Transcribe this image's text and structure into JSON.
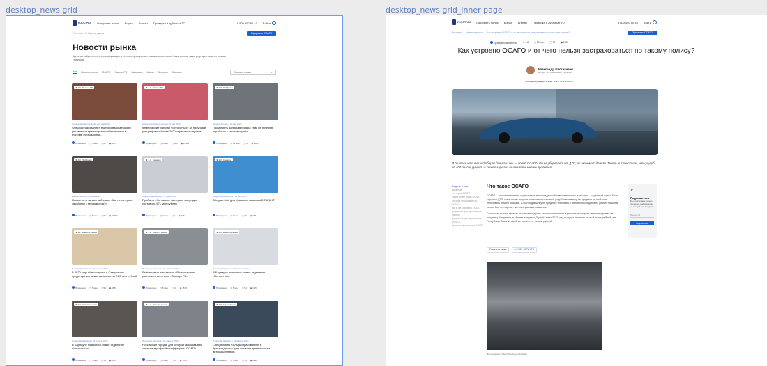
{
  "frames": {
    "grid_label": "desktop_news grid",
    "inner_label": "desktop_news grid_inner page"
  },
  "header": {
    "logo_top": "РОССТРАХ",
    "logo_sub": "Онлайн Страхование",
    "nav": [
      "Оформить полис",
      "Биржа",
      "Агенты",
      "Проверка и дубликат ТО"
    ],
    "phone": "8 800 550 50 43",
    "login": "Войти"
  },
  "grid_page": {
    "breadcrumb": "Росстрах → Новости рынка",
    "cta": "Оформить ОСАГО",
    "title": "Новости рынка",
    "intro": "Здесь вы найдете полезную информацию в статьях, проверенных нашими экспертами. Наши авторы также регулярно пишут о разных тематиках.",
    "tabs": [
      "Все",
      "Новости рынка",
      "ОСАГО",
      "Законы РФ",
      "Лайфхаки",
      "Акции",
      "Вопросы",
      "Санкции"
    ],
    "sort": "Сначала новые",
    "cards": [
      {
        "rating": "4.3",
        "label": "Законы РФ",
        "meta": "Александра Евстигнеева • 19 мая 2023",
        "title": "«Альфастрахование» застраховало автопарк управления транспортного обеспечения в Ростове учитывая нов...",
        "v": "Проверено",
        "time": "7 мин",
        "c": "22",
        "views": "1579",
        "color": "#7a4a3a"
      },
      {
        "rating": "4.3",
        "label": "Законы РФ",
        "meta": "Александра Евстигнеева • 19 мая 2023",
        "title": "Кемеровский филиал «Ингосстрах» за полугодие урегулировал более 2800 страховых случаев",
        "v": "Проверено",
        "time": "8 мин",
        "c": "128",
        "views": "11583",
        "color": "#c85a6a"
      },
      {
        "rating": "4.3",
        "label": "Лайфхаки",
        "meta": "Евгений Егоров • 15 мая 2023",
        "title": "Посмотреть запись вебинара «Как не потерять заработок с тексокмотра?»",
        "v": "Проверено",
        "time": "15 мин",
        "c": "78",
        "views": "2289",
        "color": "#6f747a"
      },
      {
        "rating": "4.3",
        "label": "Лайфхаки",
        "meta": "Евгений Егоров • 15 мая 2023",
        "title": "Посмотреть запись вебинара «Как не потерять заработок с тексокмотра?»",
        "v": "Проверено",
        "time": "5 мин",
        "c": "62",
        "views": "22880",
        "color": "#4f4a48"
      },
      {
        "rating": "4.3",
        "label": "Санкции",
        "meta": "Андрей Киревейтеру • 15 мая 2023",
        "title": "Прибыль «Согласия» за первое полугодие составила 971 млн рублей",
        "v": "Проверено",
        "time": "4 мин",
        "c": "5",
        "views": "678",
        "color": "#c9ced4"
      },
      {
        "rating": "4.3",
        "label": "Санкции",
        "meta": "Андрей Киревейтеру • 15 мая 2023",
        "title": "Telegram bot, для Крыма по лимитам Е-ГАРАНТ",
        "v": "Проверено",
        "time": "1 мин",
        "c": "28",
        "views": "467",
        "color": "#3f8fd0"
      },
      {
        "rating": "4.2",
        "label": "Новости рынка",
        "meta": "Полиграф Шариков • 22 апреля 2022",
        "title": "В 2020 году «Ингосстрах» в Ставрополе предотвратил мошенничество на 21,5 млн рублей",
        "v": "Проверено",
        "time": "5 мин",
        "c": "54",
        "views": "1578",
        "color": "#d9c7a8"
      },
      {
        "rating": "4.2",
        "label": "Новости рынка",
        "meta": "Полиграф Шариков • 22 апреля 2022",
        "title": "Рейтинговые показатели «Росгосстраха» увеличило агентство «Эксперт РА»",
        "v": "Проверено",
        "time": "5 мин",
        "c": "54",
        "views": "1578",
        "color": "#8a8f94"
      },
      {
        "rating": "4.3",
        "label": "Новости рынка",
        "meta": "Полиграф Шариков • 22 апреля 2022",
        "title": "В Барнауле появилось новое отделение «Ингосстрах»",
        "v": "Проверено",
        "time": "5 мин",
        "c": "54",
        "views": "1470",
        "color": "#d8dbe0"
      },
      {
        "rating": "4.2",
        "label": "Новости рынка",
        "meta": "Полиграф Шариков • 22 апреля 2022",
        "title": "В Барнауле появилось новое отделение «Ингосстрах»",
        "v": "Проверено",
        "time": "5 мин",
        "c": "54",
        "views": "1578",
        "color": "#5a5550"
      },
      {
        "rating": "4.2",
        "label": "Новости рынка",
        "meta": "Полиграф Шариков • 22 апреля 2022",
        "title": "Российские города, для которых максимально снизили тарифный коэффициент ОСАГО",
        "v": "Проверено",
        "time": "5 мин",
        "c": "54",
        "views": "1578",
        "color": "#7d8388"
      },
      {
        "rating": "4.3",
        "label": "Страхование",
        "meta": "Полиграф Шариков • 22 апреля 2022",
        "title": "Специалисты «Альфастрахования» в Краснодарском крае выявили деятельности автомошенников",
        "v": "Проверено",
        "time": "5 мин",
        "c": "54",
        "views": "2232",
        "color": "#3a4a5a"
      }
    ]
  },
  "inner_page": {
    "breadcrumb": "Росстрах → Новости рынка → Как устроено ОСАГО и от чего нельзя застраховаться по такому полису?",
    "cta": "Оформить ОСАГО",
    "badges": [
      "Проверено экспертом",
      "4.8",
      "10 мин",
      "78",
      "2280"
    ],
    "title": "Как устроено ОСАГО и от чего нельзя застраховаться по такому полису?",
    "author": "Александр Евстигнеев",
    "role": "Эксперт по страхованию, публицист",
    "updated_label": "Последняя редакция статьи:",
    "updated_date": "00:28, 16 мая 2023 г.",
    "lead": "Я считаю, что лучший оберег для машины — полис ОСАГО. Он не уберегает от ДТП, но экономит деньги. Теперь я точно знаю, что ущерб до 400 тысяч рублей из своего кармана оплачивать мне не придется",
    "toc": [
      "Разделы статьи",
      "Введение",
      "Что такое ОСАГО",
      "Зачем нужен полис ОСАГО",
      "Условия страхования по ОСАГО",
      "Как и где оформить ОСАГО",
      "Документы для оформления полиса",
      "Документы для оформления ОСАГО",
      "Правила оформления ОСАГО"
    ],
    "section_title": "Что такое ОСАГО",
    "p1": "ОСАГО — это обязательное страхование автогражданской ответственности, а по сути — страховой полис. Если случится ДТП, такой полис покроет нанесенный машиной ущерб и виновнику не придется за свой счет оплачивать ремонт машины. А пострадавшему не придется требовать с виновного средства на ремонт машины лично. Все это сделает за них страховая компания.",
    "p2": "Стоимость полиса зависит от стажа вождения, мощности машины и региона, в котором зарегистрирован ее владелец. Например, в Москве владелец Лады Калины 2013 года выпуска заплатит около 4 тысяч рублей, а в Республике Тыва за такой же полис — 2 тысячи рублей.",
    "tags": [
      "Статьи по теме",
      "ст. 1 ФЗ об ОСАГО"
    ],
    "caption": "Фотография от Sarah Navsky на Unsplash",
    "subscribe": {
      "title": "Подпишитесь",
      "text": "Мы присылаем только полезную информацию на почту 1 раз в неделю",
      "placeholder": "Ваш email",
      "button": "Подписаться"
    }
  }
}
